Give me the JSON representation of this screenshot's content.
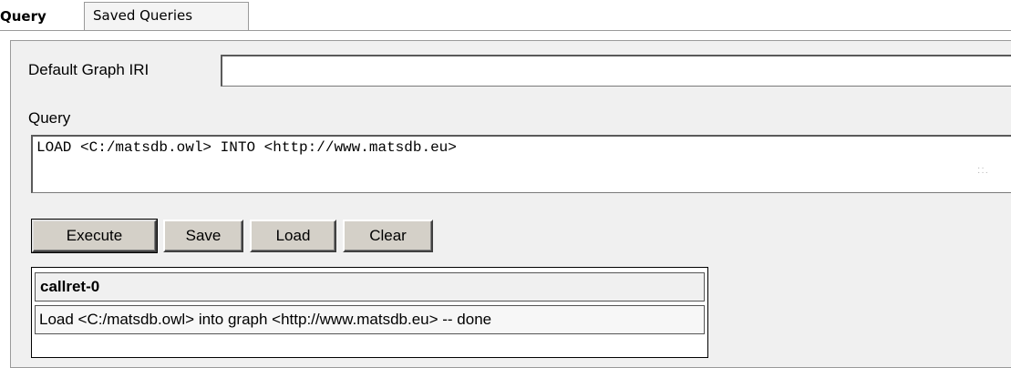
{
  "tabs": [
    {
      "label": "Query",
      "active": true
    },
    {
      "label": "Saved Queries",
      "active": false
    }
  ],
  "form": {
    "default_graph_iri_label": "Default Graph IRI",
    "default_graph_iri_value": "",
    "query_label": "Query",
    "query_value": "LOAD <C:/matsdb.owl> INTO <http://www.matsdb.eu>"
  },
  "buttons": {
    "execute": "Execute",
    "save": "Save",
    "load": "Load",
    "clear": "Clear"
  },
  "result": {
    "column_header": "callret-0",
    "rows": [
      "Load <C:/matsdb.owl> into graph <http://www.matsdb.eu> -- done"
    ]
  }
}
